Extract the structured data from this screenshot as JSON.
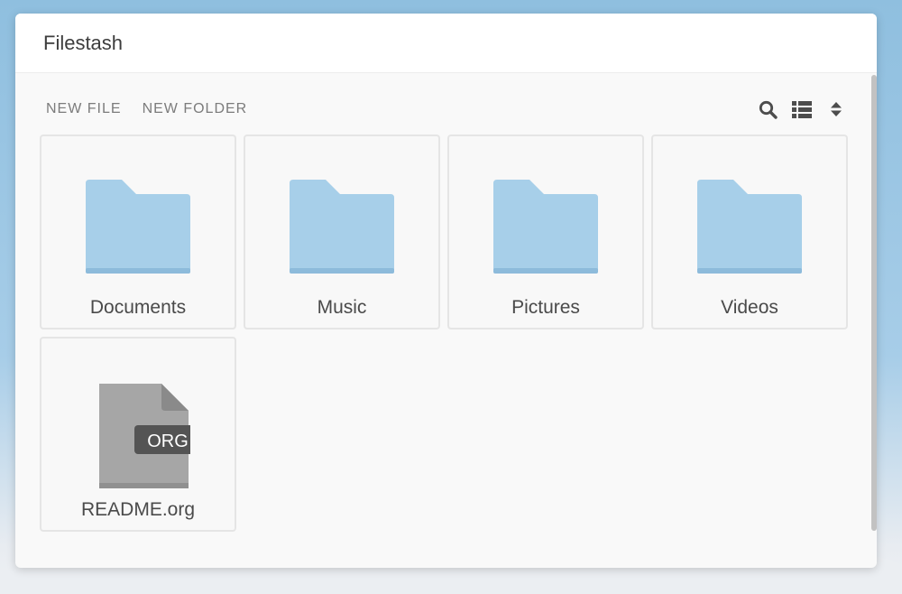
{
  "window": {
    "title": "Filestash"
  },
  "toolbar": {
    "new_file_label": "NEW FILE",
    "new_folder_label": "NEW FOLDER",
    "icons": [
      "search-icon",
      "list-view-icon",
      "sort-icon"
    ]
  },
  "items": [
    {
      "name": "Documents",
      "type": "folder"
    },
    {
      "name": "Music",
      "type": "folder"
    },
    {
      "name": "Pictures",
      "type": "folder"
    },
    {
      "name": "Videos",
      "type": "folder"
    },
    {
      "name": "README.org",
      "type": "file",
      "badge": "ORG"
    }
  ],
  "colors": {
    "folder": "#a7cfe9",
    "folder_shade": "#8dbbdb",
    "file": "#a6a6a6",
    "file_fold": "#8a8a8a",
    "badge": "#545454"
  }
}
